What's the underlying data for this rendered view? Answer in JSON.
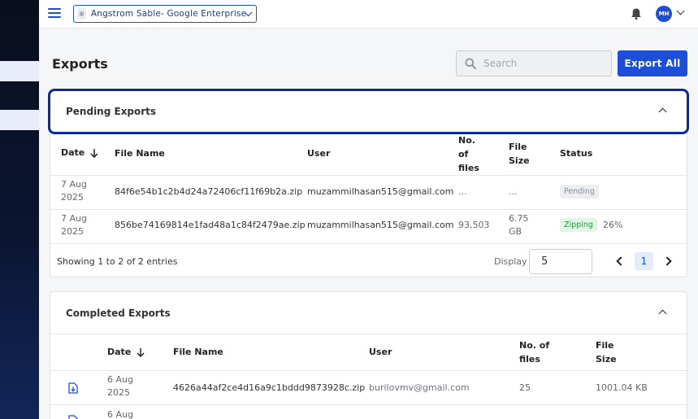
{
  "topbar": {
    "org_name": "Angstrom Sable- Google Enterprise",
    "avatar_initials": "MH",
    "icons": [
      "hamburger-icon",
      "org-logo-icon",
      "chevron-down-icon",
      "bell-icon",
      "chevron-down-icon"
    ]
  },
  "page": {
    "title": "Exports",
    "search_placeholder": "Search",
    "export_all_label": "Export All"
  },
  "pending": {
    "title": "Pending Exports",
    "columns": {
      "date": "Date",
      "file_name": "File Name",
      "user": "User",
      "num_files_l1": "No.",
      "num_files_l2": "of",
      "num_files_l3": "files",
      "size_l1": "File",
      "size_l2": "Size",
      "status": "Status"
    },
    "rows": [
      {
        "date_l1": "7 Aug",
        "date_l2": "2025",
        "file_name": "84f6e54b1c2b4d24a72406cf11f69b2a.zip",
        "user": "muzammilhasan515@gmail.com",
        "num_files": "...",
        "size_l1": "...",
        "size_l2": "",
        "status": "Pending",
        "progress": ""
      },
      {
        "date_l1": "7 Aug",
        "date_l2": "2025",
        "file_name": "856be74169814e1fad48a1c84f2479ae.zip",
        "user": "muzammilhasan515@gmail.com",
        "num_files": "93,503",
        "size_l1": "6.75",
        "size_l2": "GB",
        "status": "Zipping",
        "progress": "26%"
      }
    ],
    "footer": {
      "showing": "Showing 1 to 2 of 2 entries",
      "display_label": "Display",
      "display_value": "5",
      "current_page": "1"
    }
  },
  "completed": {
    "title": "Completed Exports",
    "columns": {
      "date": "Date",
      "file_name": "File Name",
      "user": "User",
      "num_files_l1": "No. of",
      "num_files_l2": "files",
      "size_l1": "File",
      "size_l2": "Size"
    },
    "rows": [
      {
        "date_l1": "6 Aug",
        "date_l2": "2025",
        "file_name": "4626a44af2ce4d16a9c1bddd9873928c.zip",
        "user": "burilovmv@gmail.com",
        "num_files": "25",
        "size": "1001.04 KB"
      },
      {
        "date_l1": "6 Aug",
        "date_l2": "",
        "file_name": "",
        "user": "",
        "num_files": "",
        "size": ""
      }
    ]
  },
  "colors": {
    "accent": "#1d4ed8",
    "focus_ring": "#0b2a9e",
    "zipping_badge": "#2e9142",
    "pending_badge": "#8a8f96"
  }
}
